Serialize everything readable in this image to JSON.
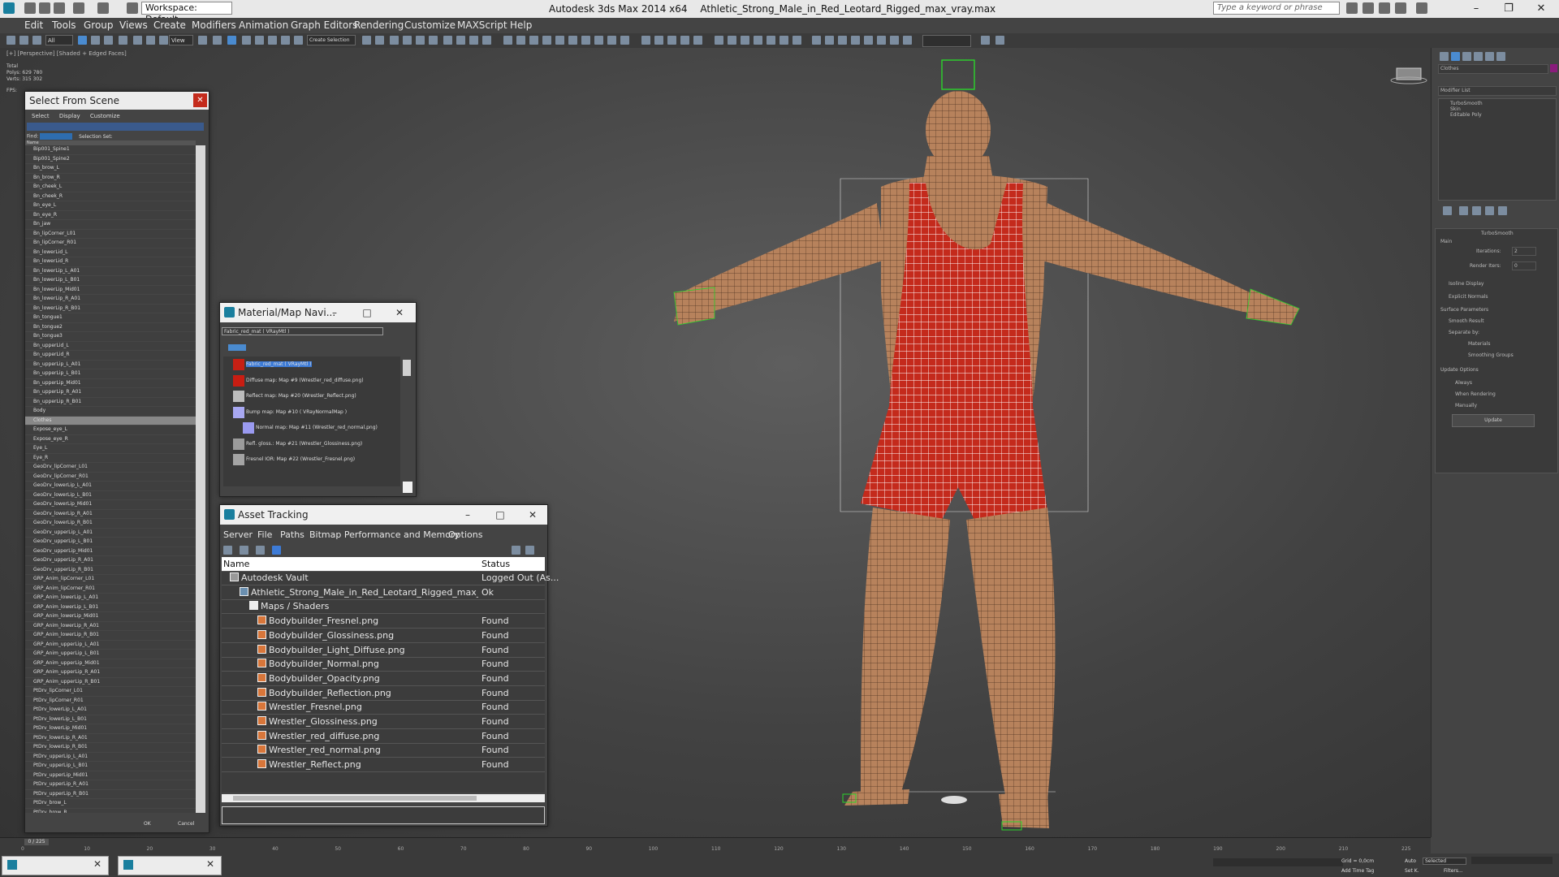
{
  "window": {
    "app_title": "Autodesk 3ds Max  2014 x64",
    "file_title": "Athletic_Strong_Male_in_Red_Leotard_Rigged_max_vray.max",
    "workspace": "Workspace: Default",
    "search_placeholder": "Type a keyword or phrase"
  },
  "menu": [
    "Edit",
    "Tools",
    "Group",
    "Views",
    "Create",
    "Modifiers",
    "Animation",
    "Graph Editors",
    "Rendering",
    "Customize",
    "MAXScript",
    "Help"
  ],
  "toolbar": {
    "selection_filter": "All",
    "ref_coord": "View",
    "selection_set": "Create Selection Se"
  },
  "viewport": {
    "label": "[+] [Perspective] [Shaded + Edged Faces]",
    "stats": {
      "total_label": "Total",
      "polys_label": "Polys:",
      "polys": "629 780",
      "verts_label": "Verts:",
      "verts": "315 302",
      "fps_label": "FPS:"
    }
  },
  "command_panel": {
    "object_name": "Clothes",
    "modifier_list": "Modifier List",
    "stack": [
      "TurboSmooth",
      "Skin",
      "Editable Poly"
    ],
    "rollout_title": "TurboSmooth",
    "main": "Main",
    "iterations_label": "Iterations:",
    "iterations": "2",
    "render_iters_label": "Render Iters:",
    "render_iters": "0",
    "isoline": "Isoline Display",
    "explicit_normals": "Explicit Normals",
    "surface_params": "Surface Parameters",
    "smooth_result": "Smooth Result",
    "separate_by": "Separate by:",
    "materials": "Materials",
    "smoothing_groups": "Smoothing Groups",
    "update_options": "Update Options",
    "always": "Always",
    "when_rendering": "When Rendering",
    "manually": "Manually",
    "update_button": "Update"
  },
  "select_from_scene": {
    "title": "Select From Scene",
    "menu": [
      "Select",
      "Display",
      "Customize"
    ],
    "find_label": "Find:",
    "selection_set_label": "Selection Set:",
    "column_name": "Name",
    "items": [
      "Bip001_Spine1",
      "Bip001_Spine2",
      "Bn_brow_L",
      "Bn_brow_R",
      "Bn_cheek_L",
      "Bn_cheek_R",
      "Bn_eye_L",
      "Bn_eye_R",
      "Bn_jaw",
      "Bn_lipCorner_L01",
      "Bn_lipCorner_R01",
      "Bn_lowerLid_L",
      "Bn_lowerLid_R",
      "Bn_lowerLip_L_A01",
      "Bn_lowerLip_L_B01",
      "Bn_lowerLip_Mid01",
      "Bn_lowerLip_R_A01",
      "Bn_lowerLip_R_B01",
      "Bn_tongue1",
      "Bn_tongue2",
      "Bn_tongue3",
      "Bn_upperLid_L",
      "Bn_upperLid_R",
      "Bn_upperLip_L_A01",
      "Bn_upperLip_L_B01",
      "Bn_upperLip_Mid01",
      "Bn_upperLip_R_A01",
      "Bn_upperLip_R_B01",
      "Body",
      "Clothes",
      "Expose_eye_L",
      "Expose_eye_R",
      "Eye_L",
      "Eye_R",
      "GeoDrv_lipCorner_L01",
      "GeoDrv_lipCorner_R01",
      "GeoDrv_lowerLip_L_A01",
      "GeoDrv_lowerLip_L_B01",
      "GeoDrv_lowerLip_Mid01",
      "GeoDrv_lowerLip_R_A01",
      "GeoDrv_lowerLip_R_B01",
      "GeoDrv_upperLip_L_A01",
      "GeoDrv_upperLip_L_B01",
      "GeoDrv_upperLip_Mid01",
      "GeoDrv_upperLip_R_A01",
      "GeoDrv_upperLip_R_B01",
      "GRP_Anim_lipCorner_L01",
      "GRP_Anim_lipCorner_R01",
      "GRP_Anim_lowerLip_L_A01",
      "GRP_Anim_lowerLip_L_B01",
      "GRP_Anim_lowerLip_Mid01",
      "GRP_Anim_lowerLip_R_A01",
      "GRP_Anim_lowerLip_R_B01",
      "GRP_Anim_upperLip_L_A01",
      "GRP_Anim_upperLip_L_B01",
      "GRP_Anim_upperLip_Mid01",
      "GRP_Anim_upperLip_R_A01",
      "GRP_Anim_upperLip_R_B01",
      "PtDrv_lipCorner_L01",
      "PtDrv_lipCorner_R01",
      "PtDrv_lowerLip_L_A01",
      "PtDrv_lowerLip_L_B01",
      "PtDrv_lowerLip_Mid01",
      "PtDrv_lowerLip_R_A01",
      "PtDrv_lowerLip_R_B01",
      "PtDrv_upperLip_L_A01",
      "PtDrv_upperLip_L_B01",
      "PtDrv_upperLip_Mid01",
      "PtDrv_upperLip_R_A01",
      "PtDrv_upperLip_R_B01",
      "PtDrv_brow_L",
      "PtDrv_brow_R",
      "PtDrv_eye_L",
      "PtDrv_eye_R",
      "PtDrv_fatheroot1",
      "PtDrv_jaw",
      "Teeth_lower",
      "Teeth_upper"
    ],
    "selected_item": "Clothes",
    "ok": "OK",
    "cancel": "Cancel"
  },
  "material_navigator": {
    "title": "Material/Map Navi...",
    "material_name": "Fabric_red_mat  ( VRayMtl )",
    "tree": [
      {
        "label": "Fabric_red_mat  ( VRayMtl )",
        "swatch": "#c62014"
      },
      {
        "label": "Diffuse map: Map #9 (Wrestler_red_diffuse.png)",
        "swatch": "#c91d12"
      },
      {
        "label": "Reflect map: Map #20 (Wrestler_Reflect.png)",
        "swatch": "#bdbdbd"
      },
      {
        "label": "Bump map: Map #10  ( VRayNormalMap )",
        "swatch": "#a8a8f2"
      },
      {
        "label": "Normal map: Map #11 (Wrestler_red_normal.png)",
        "swatch": "#9a9af0"
      },
      {
        "label": "Refl. gloss.: Map #21 (Wrestler_Glossiness.png)",
        "swatch": "#9b9b9b"
      },
      {
        "label": "Fresnel IOR: Map #22 (Wrestler_Fresnel.png)",
        "swatch": "#a4a4a4"
      }
    ]
  },
  "asset_tracking": {
    "title": "Asset Tracking",
    "menu": [
      "Server",
      "File",
      "Paths",
      "Bitmap Performance and Memory",
      "Options"
    ],
    "col_name": "Name",
    "col_status": "Status",
    "rows": [
      {
        "name": "Autodesk Vault",
        "status": "Logged Out (As..."
      },
      {
        "name": "Athletic_Strong_Male_in_Red_Leotard_Rigged_max_vray....",
        "status": "Ok"
      },
      {
        "name": "Maps / Shaders",
        "status": ""
      },
      {
        "name": "Bodybuilder_Fresnel.png",
        "status": "Found"
      },
      {
        "name": "Bodybuilder_Glossiness.png",
        "status": "Found"
      },
      {
        "name": "Bodybuilder_Light_Diffuse.png",
        "status": "Found"
      },
      {
        "name": "Bodybuilder_Normal.png",
        "status": "Found"
      },
      {
        "name": "Bodybuilder_Opacity.png",
        "status": "Found"
      },
      {
        "name": "Bodybuilder_Reflection.png",
        "status": "Found"
      },
      {
        "name": "Wrestler_Fresnel.png",
        "status": "Found"
      },
      {
        "name": "Wrestler_Glossiness.png",
        "status": "Found"
      },
      {
        "name": "Wrestler_red_diffuse.png",
        "status": "Found"
      },
      {
        "name": "Wrestler_red_normal.png",
        "status": "Found"
      },
      {
        "name": "Wrestler_Reflect.png",
        "status": "Found"
      }
    ]
  },
  "timeline": {
    "frame_counter": "0 / 225",
    "ticks": [
      "0",
      "10",
      "20",
      "30",
      "40",
      "50",
      "60",
      "70",
      "80",
      "90",
      "100",
      "110",
      "120",
      "130",
      "140",
      "150",
      "160",
      "170",
      "180",
      "190",
      "200",
      "210",
      "225"
    ]
  },
  "status_bar": {
    "grid": "Grid = 0,0cm",
    "auto": "Auto",
    "selected": "Selected",
    "add_time_tag": "Add Time Tag",
    "set_k": "Set K.",
    "filters": "Filters..."
  }
}
